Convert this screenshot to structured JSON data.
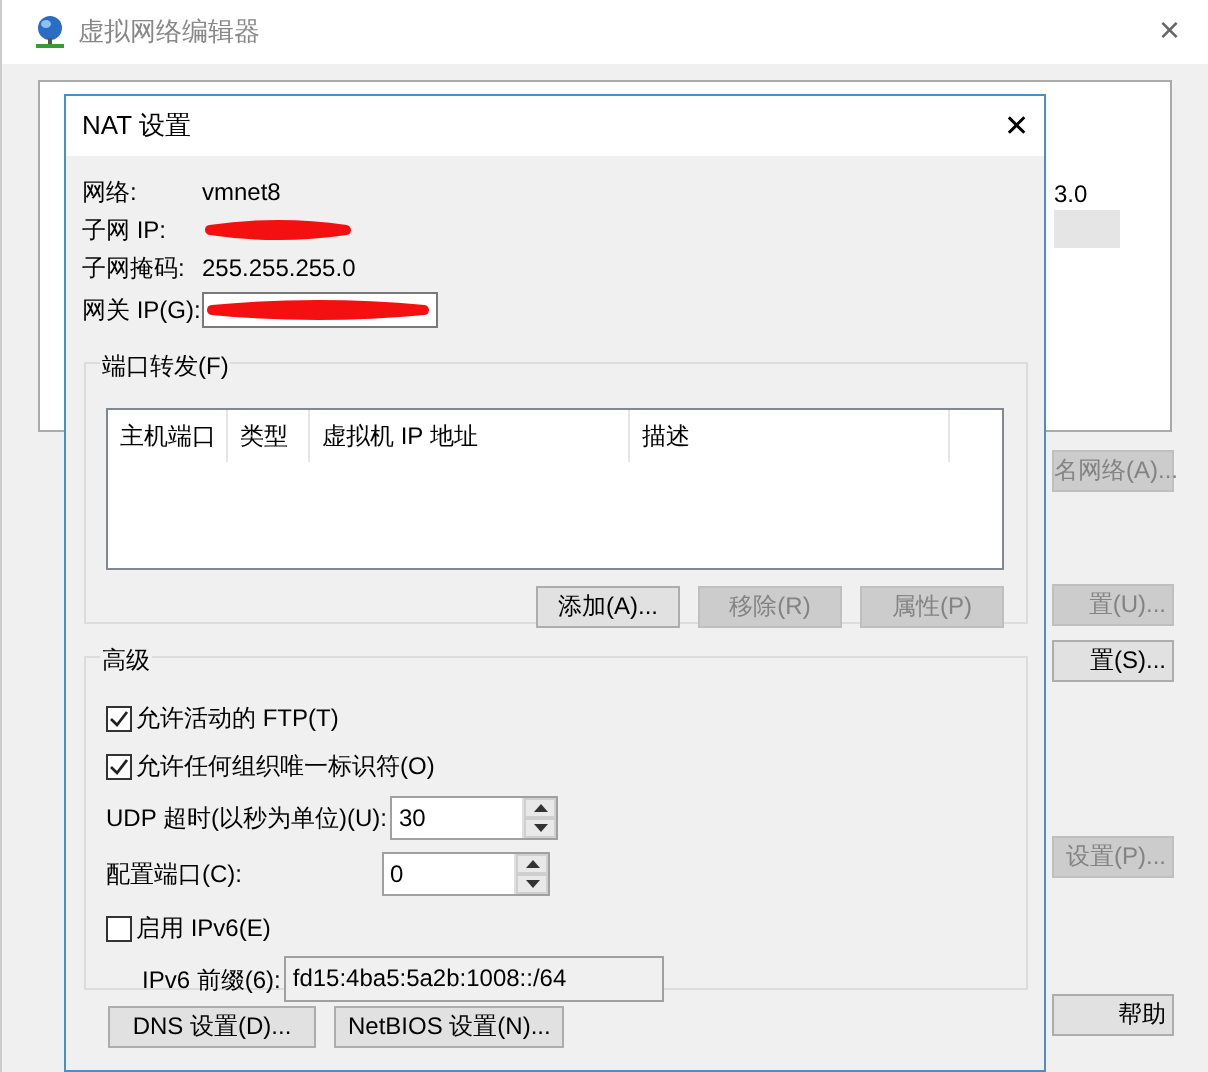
{
  "window": {
    "title": "虚拟网络编辑器",
    "close_glyph": "×"
  },
  "background_list": {
    "rows": [
      {
        "trailing": "3.0",
        "selected": false
      },
      {
        "selected": true
      }
    ]
  },
  "background_buttons": [
    {
      "label": "名网络(A)...",
      "disabled": true,
      "kind": "right"
    },
    {
      "label": "置(U)...",
      "disabled": true,
      "kind": "right"
    },
    {
      "label": "置(S)...",
      "disabled": false,
      "kind": "right"
    },
    {
      "label": "设置(P)...",
      "disabled": true,
      "kind": "right"
    },
    {
      "label": "帮助",
      "disabled": false,
      "kind": "right"
    }
  ],
  "dialog": {
    "title": "NAT 设置",
    "close_glyph": "✕",
    "info": [
      {
        "label": "网络:",
        "value": "vmnet8",
        "kind": "text"
      },
      {
        "label": "子网 IP:",
        "kind": "redacted"
      },
      {
        "label": "子网掩码:",
        "value": "255.255.255.0",
        "kind": "text"
      },
      {
        "label": "网关 IP(G):",
        "kind": "redacted_field"
      }
    ],
    "port_forwarding": {
      "title": "端口转发(F)",
      "columns": [
        "主机端口",
        "类型",
        "虚拟机 IP 地址",
        "描述"
      ],
      "buttons": [
        {
          "label": "添加(A)...",
          "disabled": false
        },
        {
          "label": "移除(R)",
          "disabled": true
        },
        {
          "label": "属性(P)",
          "disabled": true
        }
      ]
    },
    "advanced": {
      "title": "高级",
      "checkboxes": [
        {
          "label": "允许活动的 FTP(T)",
          "checked": true
        },
        {
          "label": "允许任何组织唯一标识符(O)",
          "checked": true
        }
      ],
      "spinners": [
        {
          "label": "UDP 超时(以秒为单位)(U):",
          "value": "30"
        },
        {
          "label": "配置端口(C):",
          "value": "0"
        }
      ],
      "ipv6": {
        "label": "启用 IPv6(E)",
        "checked": false
      },
      "prefix": {
        "label": "IPv6 前缀(6):",
        "value": "fd15:4ba5:5a2b:1008::/64",
        "disabled": true
      }
    },
    "buttons": [
      {
        "label": "DNS 设置(D)..."
      },
      {
        "label": "NetBIOS 设置(N)..."
      }
    ]
  }
}
